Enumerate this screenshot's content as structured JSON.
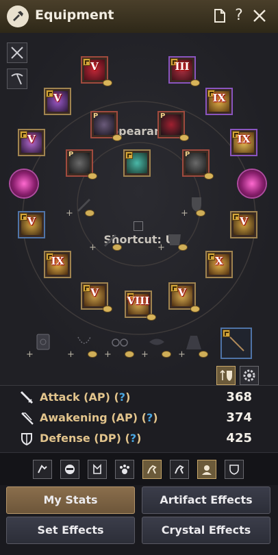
{
  "window": {
    "title": "Equipment",
    "title_icon": "equipment-hammer-icon",
    "buttons": {
      "page": "page-icon",
      "help": "?",
      "close": "close-icon"
    }
  },
  "equipment": {
    "appearance_label": "Appearance",
    "shortcut_label": "Shortcut: U",
    "slots": [
      {
        "name": "helmet-slot",
        "rank": "V",
        "frame": "gold"
      },
      {
        "name": "armor-top-slot",
        "rank": "III",
        "frame": "purple"
      },
      {
        "name": "left-gear-slot-1",
        "rank": "V",
        "frame": "gold"
      },
      {
        "name": "right-gear-slot-1",
        "rank": "IX",
        "frame": "purple"
      },
      {
        "name": "left-gear-slot-2",
        "rank": "V",
        "frame": "gold"
      },
      {
        "name": "right-gear-slot-2",
        "rank": "IX",
        "frame": "purple"
      },
      {
        "name": "left-gear-slot-4",
        "rank": "V",
        "frame": "blue"
      },
      {
        "name": "right-gear-slot-4",
        "rank": "V",
        "frame": "gold"
      },
      {
        "name": "left-gear-slot-5",
        "rank": "IX",
        "frame": "gold"
      },
      {
        "name": "right-gear-slot-5",
        "rank": "X",
        "frame": "gold"
      },
      {
        "name": "lower-left-slot",
        "rank": "V",
        "frame": "gold"
      },
      {
        "name": "bottom-slot",
        "rank": "VIII",
        "frame": "gold"
      },
      {
        "name": "lower-right-slot",
        "rank": "V",
        "frame": "gold"
      }
    ],
    "appearance_prefix": "P"
  },
  "stats": {
    "attack": {
      "label": "Attack (AP)",
      "q": "?",
      "value": "368",
      "icon": "sword-icon"
    },
    "awakening": {
      "label": "Awakening (AP)",
      "q": "?",
      "value": "374",
      "icon": "awakening-blade-icon"
    },
    "defense": {
      "label": "Defense (DP)",
      "q": "?",
      "value": "425",
      "icon": "shield-icon"
    },
    "open_paren": "(",
    "close_paren": ")"
  },
  "tabs": [
    {
      "name": "tab-character-icon"
    },
    {
      "name": "tab-mask-icon"
    },
    {
      "name": "tab-outfit-icon"
    },
    {
      "name": "tab-pet-icon"
    },
    {
      "name": "tab-horse-icon",
      "active": true
    },
    {
      "name": "tab-horse-2-icon"
    },
    {
      "name": "tab-portrait-icon",
      "active": true
    },
    {
      "name": "tab-guard-icon"
    }
  ],
  "buttons": {
    "my_stats": "My Stats",
    "artifact_effects": "Artifact Effects",
    "set_effects": "Set Effects",
    "crystal_effects": "Crystal Effects"
  },
  "colors": {
    "accent_gold": "#e2c48c",
    "help_blue": "#4aa6e0",
    "rank_red": "#c01818"
  }
}
